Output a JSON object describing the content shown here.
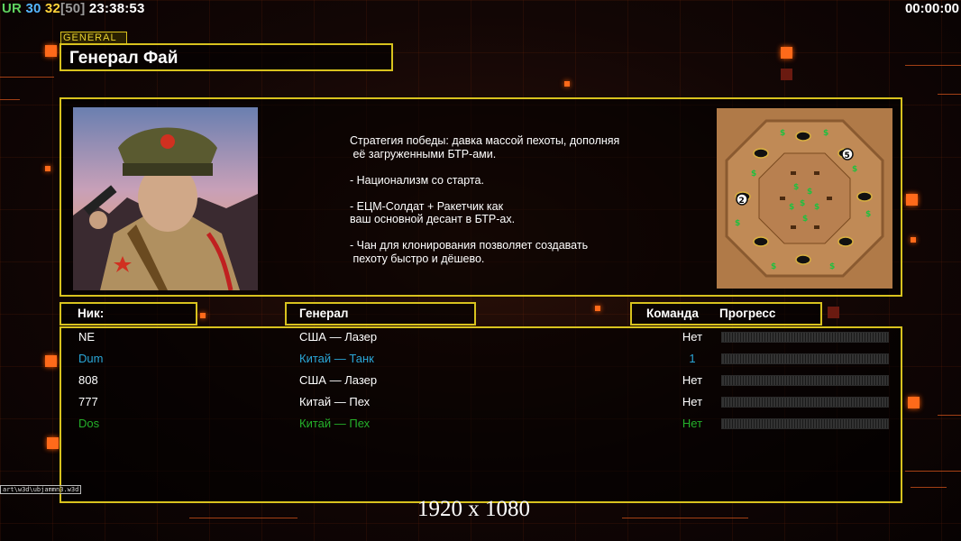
{
  "hud": {
    "ur": "UR",
    "val1": "30",
    "val2": "32",
    "val3": "[50]",
    "clock": "23:38:53",
    "timer": "00:00:00"
  },
  "general": {
    "tag": "GENERAL",
    "name": "Генерал Фай",
    "description": "Стратегия победы: давка массой пехоты, дополняя\n её загруженными БТР-ами.\n\n- Национализм со старта.\n\n- ЕЦМ-Солдат + Ракетчик как\nваш основной десант в БТР-ах.\n\n- Чан для клонирования позволяет создавать\n пехоту быстро и дёшево."
  },
  "minimap": {
    "markers": [
      "2",
      "5"
    ]
  },
  "table": {
    "headers": {
      "nick": "Ник:",
      "general": "Генерал",
      "team": "Команда",
      "progress": "Прогресс"
    },
    "rows": [
      {
        "nick": "NE",
        "general": "США — Лазер",
        "team": "Нет",
        "color": "white"
      },
      {
        "nick": "Dum",
        "general": "Китай — Танк",
        "team": "1",
        "color": "blue"
      },
      {
        "nick": "808",
        "general": "США — Лазер",
        "team": "Нет",
        "color": "white"
      },
      {
        "nick": "777",
        "general": "Китай — Пех",
        "team": "Нет",
        "color": "white"
      },
      {
        "nick": "Dos",
        "general": "Китай — Пех",
        "team": "Нет",
        "color": "green"
      }
    ]
  },
  "footer": {
    "watermark": "art\\w3d\\ubjammn3.w3d",
    "resolution": "1920 x 1080"
  },
  "colors": {
    "accent": "#d8c21e",
    "blue": "#2aa7d8",
    "green": "#24b02a",
    "orange": "#ff6a1a"
  }
}
